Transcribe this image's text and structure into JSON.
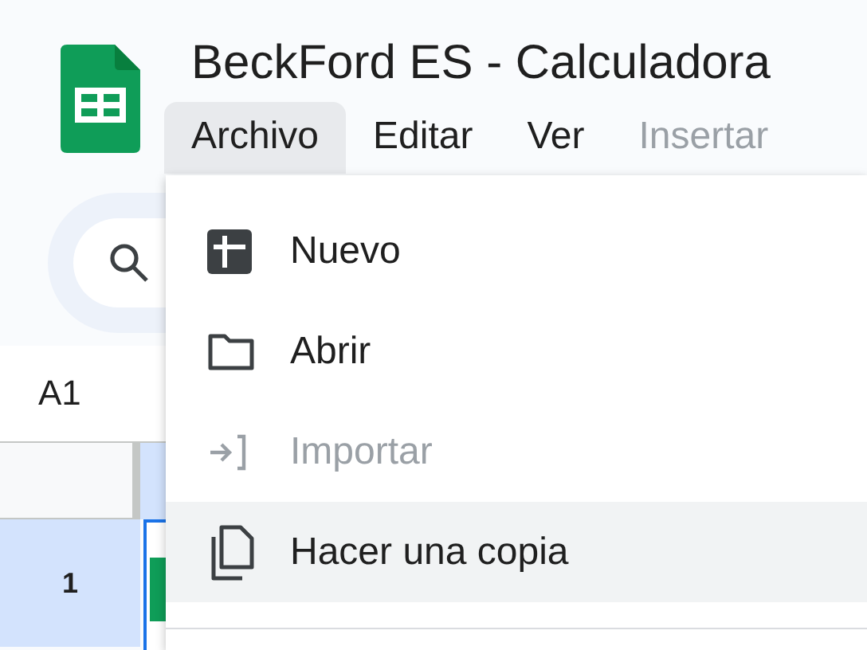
{
  "document": {
    "title": "BeckFord ES - Calculadora"
  },
  "menu_bar": [
    {
      "label": "Archivo",
      "selected": true,
      "disabled": false
    },
    {
      "label": "Editar",
      "selected": false,
      "disabled": false
    },
    {
      "label": "Ver",
      "selected": false,
      "disabled": false
    },
    {
      "label": "Insertar",
      "selected": false,
      "disabled": true
    }
  ],
  "name_box": {
    "value": "A1"
  },
  "row_headers": [
    "1"
  ],
  "file_menu": {
    "items": [
      {
        "label": "Nuevo",
        "kind": "new",
        "disabled": false,
        "selected": false
      },
      {
        "label": "Abrir",
        "kind": "open",
        "disabled": false,
        "selected": false
      },
      {
        "label": "Importar",
        "kind": "import",
        "disabled": true,
        "selected": false
      },
      {
        "label": "Hacer una copia",
        "kind": "copy",
        "disabled": false,
        "selected": true
      }
    ]
  }
}
